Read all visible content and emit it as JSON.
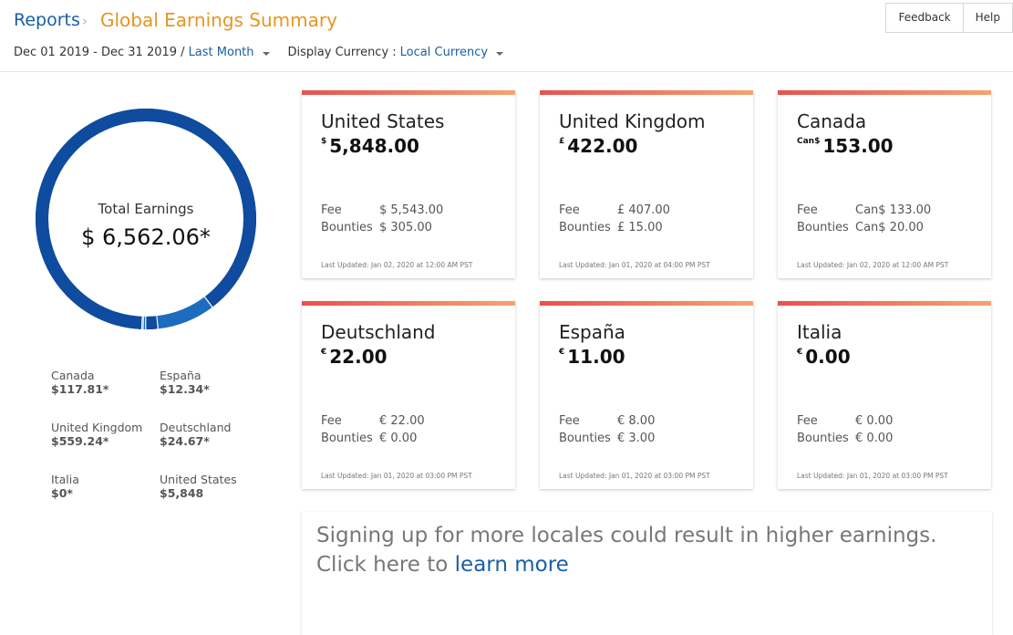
{
  "header": {
    "breadcrumb_root": "Reports",
    "breadcrumb_sep": "›",
    "title": "Global Earnings Summary",
    "feedback_label": "Feedback",
    "help_label": "Help"
  },
  "filters": {
    "date_range": "Dec 01 2019 - Dec 31 2019 /",
    "period": "Last Month",
    "currency_label": "Display Currency :",
    "currency": "Local Currency"
  },
  "summary": {
    "total_label": "Total Earnings",
    "total_value": "$ 6,562.06*",
    "legend": [
      {
        "name": "Canada",
        "value": "$117.81*"
      },
      {
        "name": "España",
        "value": "$12.34*"
      },
      {
        "name": "United Kingdom",
        "value": "$559.24*"
      },
      {
        "name": "Deutschland",
        "value": "$24.67*"
      },
      {
        "name": "Italia",
        "value": "$0*"
      },
      {
        "name": "United States",
        "value": "$5,848"
      }
    ],
    "donut_segments": [
      {
        "name": "United States",
        "value": 5848,
        "color": "#0f4b9f"
      },
      {
        "name": "United Kingdom",
        "value": 559.24,
        "color": "#1c6cc0"
      },
      {
        "name": "Canada",
        "value": 117.81,
        "color": "#0f4b9f"
      },
      {
        "name": "Deutschland",
        "value": 24.67,
        "color": "#1c6cc0"
      },
      {
        "name": "España",
        "value": 12.34,
        "color": "#0f4b9f"
      },
      {
        "name": "Italia",
        "value": 0,
        "color": "#1c6cc0"
      }
    ]
  },
  "cards": [
    {
      "country": "United States",
      "currency": "$",
      "amount": "5,848.00",
      "fee_label": "Fee",
      "fee": "$ 5,543.00",
      "bounties_label": "Bounties",
      "bounties": "$ 305.00",
      "updated": "Last Updated: Jan 02, 2020 at 12:00 AM PST"
    },
    {
      "country": "United Kingdom",
      "currency": "£",
      "amount": "422.00",
      "fee_label": "Fee",
      "fee": "£ 407.00",
      "bounties_label": "Bounties",
      "bounties": "£ 15.00",
      "updated": "Last Updated: Jan 01, 2020 at 04:00 PM PST"
    },
    {
      "country": "Canada",
      "currency": "Can$",
      "amount": "153.00",
      "fee_label": "Fee",
      "fee": "Can$ 133.00",
      "bounties_label": "Bounties",
      "bounties": "Can$ 20.00",
      "updated": "Last Updated: Jan 02, 2020 at 12:00 AM PST"
    },
    {
      "country": "Deutschland",
      "currency": "€",
      "amount": "22.00",
      "fee_label": "Fee",
      "fee": "€ 22.00",
      "bounties_label": "Bounties",
      "bounties": "€ 0.00",
      "updated": "Last Updated: Jan 01, 2020 at 03:00 PM PST"
    },
    {
      "country": "España",
      "currency": "€",
      "amount": "11.00",
      "fee_label": "Fee",
      "fee": "€ 8.00",
      "bounties_label": "Bounties",
      "bounties": "€ 3.00",
      "updated": "Last Updated: Jan 01, 2020 at 03:00 PM PST"
    },
    {
      "country": "Italia",
      "currency": "€",
      "amount": "0.00",
      "fee_label": "Fee",
      "fee": "€ 0.00",
      "bounties_label": "Bounties",
      "bounties": "€ 0.00",
      "updated": "Last Updated: Jan 01, 2020 at 03:00 PM PST"
    }
  ],
  "promo": {
    "text": "Signing up for more locales could result in higher earnings. Click here to ",
    "link": "learn more"
  },
  "colors": {
    "link": "#1a5fa3",
    "title_accent": "#e7951e",
    "donut_primary": "#0f4b9f",
    "donut_secondary": "#1c6cc0",
    "card_bar_start": "#e8514f",
    "card_bar_end": "#f5a371"
  }
}
